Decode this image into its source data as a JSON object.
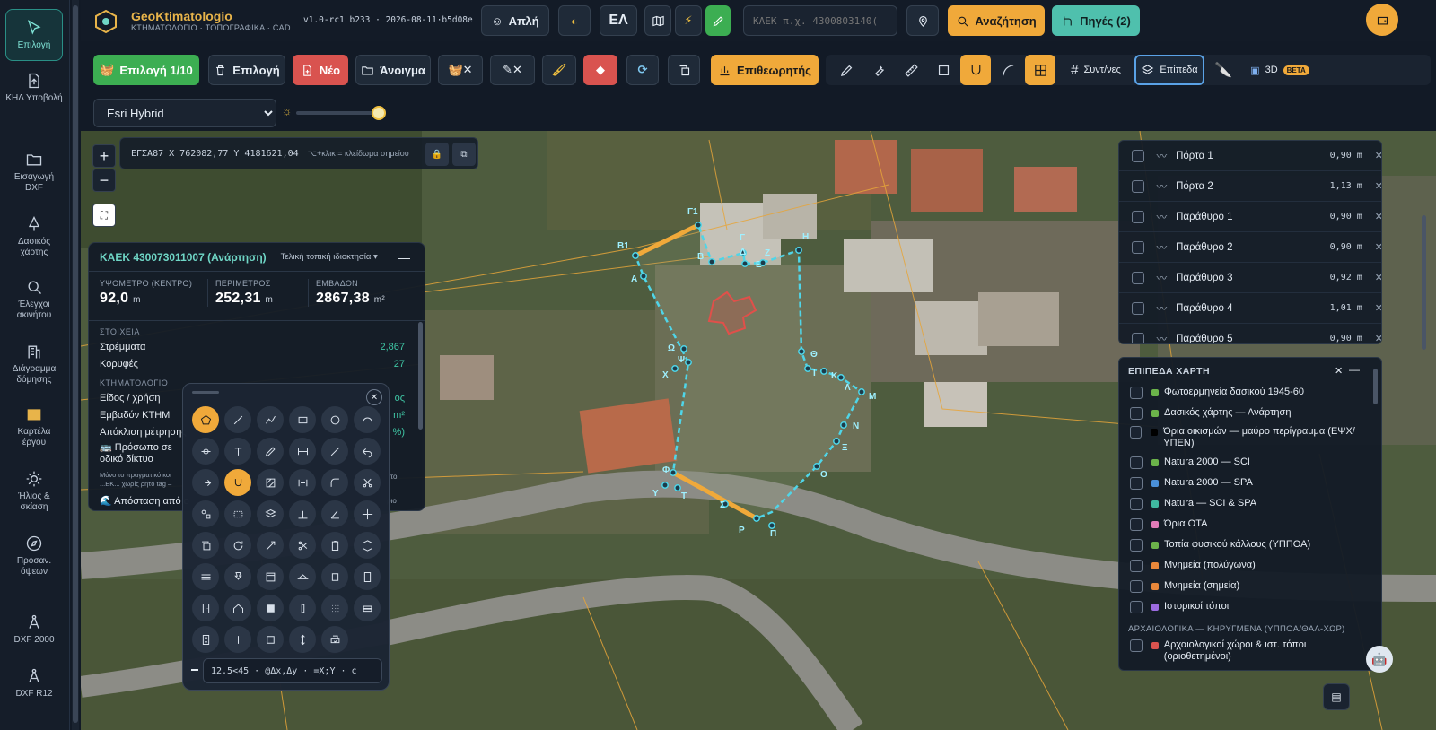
{
  "rail": [
    {
      "label": "Επιλογή",
      "icon": "cursor-icon"
    },
    {
      "label": "ΚΗΔ Υποβολή",
      "icon": "document-upload-icon"
    },
    {
      "label": "Εισαγωγή DXF",
      "icon": "folder-icon"
    },
    {
      "label": "Δασικός χάρτης",
      "icon": "tree-icon"
    },
    {
      "label": "Έλεγχοι ακινήτου",
      "icon": "search-icon"
    },
    {
      "label": "Διάγραμμα δόμησης",
      "icon": "building-icon"
    },
    {
      "label": "Καρτέλα έργου",
      "icon": "card-icon"
    },
    {
      "label": "Ήλιος & σκίαση",
      "icon": "sun-icon"
    },
    {
      "label": "Προσαν. όψεων",
      "icon": "compass-icon"
    },
    {
      "label": "DXF 2000",
      "icon": "compass-draw-icon"
    },
    {
      "label": "DXF R12",
      "icon": "compass-draw-icon"
    }
  ],
  "app": {
    "name": "GeoKtimatologio",
    "subtitle": "ΚΤΗΜΑΤΟΛΟΓΙΟ · ΤΟΠΟΓΡΑΦΙΚΑ · CAD",
    "version": "v1.0-rc1 b233 · 2026-08-11·b5d08e"
  },
  "topbar": {
    "mode_label": "Απλή",
    "lang_label": "ΕΛ",
    "search_placeholder": "ΚΑΕΚ π.χ. 4300803140(",
    "search_label": "Αναζήτηση",
    "sources_label": "Πηγές (2)"
  },
  "toolbar": {
    "select_count": "Επιλογή 1/10",
    "select_label": "Επιλογή",
    "new_label": "Νέο",
    "open_label": "Άνοιγμα",
    "viewer_label": "Επιθεωρητής",
    "grid_label": "Συντ/νες",
    "layers_label": "Επίπεδα",
    "d3_label": "3D",
    "beta": "BETA"
  },
  "basemap": {
    "selected": "Esri Hybrid",
    "options": [
      "Esri Hybrid"
    ]
  },
  "coord": {
    "text": "ΕΓΣΑ87 X 762082,77 Y 4181621,04",
    "hint": "⌥+κλικ = κλείδωμα σημείου"
  },
  "parcel": {
    "title": "ΚΑΕΚ 430073011007 (Ανάρτηση)",
    "ownership": "Τελική τοπική ιδιοκτησία",
    "stats": [
      {
        "label": "ΥΨΟΜΕΤΡΟ (ΚΕΝΤΡΟ)",
        "value": "92,0",
        "unit": "m"
      },
      {
        "label": "ΠΕΡΙΜΕΤΡΟΣ",
        "value": "252,31",
        "unit": "m"
      },
      {
        "label": "ΕΜΒΑΔΟΝ",
        "value": "2867,38",
        "unit": "m²"
      }
    ],
    "sec1": "ΣΤΟΙΧΕΙΑ",
    "rows1": [
      {
        "k": "Στρέμματα",
        "v": "2,867"
      },
      {
        "k": "Κορυφές",
        "v": "27"
      }
    ],
    "sec2": "ΚΤΗΜΑΤΟΛΟΓΙΟ",
    "rows2": [
      {
        "k": "Είδος / χρήση",
        "v": "ος"
      },
      {
        "k": "Εμβαδόν ΚΤΗΜ",
        "v": "m²"
      },
      {
        "k": "Απόκλιση μέτρησης",
        "v": "%)"
      }
    ],
    "road": "🚌 Πρόσωπο σε οδικό δίκτυο",
    "road_note": "Μόνο το πραγματικό κοι ...ΕΚ... χωρίς ρητό tag –",
    "road_note_r": "το",
    "distance": "🌊 Απόσταση από ο",
    "distance_r": "ριο"
  },
  "palette": {
    "input": "12.5<45 · @Δx,Δy · =X;Y · c"
  },
  "openings": [
    {
      "name": "Πόρτα 1",
      "value": "0,90 m"
    },
    {
      "name": "Πόρτα 2",
      "value": "1,13 m"
    },
    {
      "name": "Παράθυρο 1",
      "value": "0,90 m"
    },
    {
      "name": "Παράθυρο 2",
      "value": "0,90 m"
    },
    {
      "name": "Παράθυρο 3",
      "value": "0,92 m"
    },
    {
      "name": "Παράθυρο 4",
      "value": "1,01 m"
    },
    {
      "name": "Παράθυρο 5",
      "value": "0,90 m"
    }
  ],
  "layers": {
    "title": "ΕΠΙΠΕΔΑ ΧΑΡΤΗ",
    "items": [
      {
        "name": "Φωτοερμηνεία δασικού 1945-60",
        "color": "#6bb34a"
      },
      {
        "name": "Δασικός χάρτης — Ανάρτηση",
        "color": "#6bb34a"
      },
      {
        "name": "Όρια οικισμών — μαύρο περίγραμμα (ΕΨΧ/ΥΠΕΝ)",
        "color": "#000000"
      },
      {
        "name": "Natura 2000 — SCI",
        "color": "#6bb34a"
      },
      {
        "name": "Natura 2000 — SPA",
        "color": "#4a90d9"
      },
      {
        "name": "Natura — SCI & SPA",
        "color": "#3fb8a0"
      },
      {
        "name": "Όρια ΟΤΑ",
        "color": "#e07bb8"
      },
      {
        "name": "Τοπία φυσικού κάλλους (ΥΠΠΟΑ)",
        "color": "#6bb34a"
      },
      {
        "name": "Μνημεία (πολύγωνα)",
        "color": "#e8873a"
      },
      {
        "name": "Μνημεία (σημεία)",
        "color": "#e8873a"
      },
      {
        "name": "Ιστορικοί τόποι",
        "color": "#9b6be0"
      }
    ],
    "section": "ΑΡΧΑΙΟΛΟΓΙΚΑ — ΚΗΡΥΓΜΕΝΑ (ΥΠΠΟΑ/ΘΑΛ-ΧΩΡ)",
    "section_items": [
      {
        "name": "Αρχαιολογικοί χώροι & ιστ. τόποι (οριοθετημένοι)",
        "color": "#d9534f"
      }
    ]
  },
  "vertices": [
    "Β1",
    "Γ1",
    "Α",
    "Β",
    "Γ",
    "Δ",
    "Ε",
    "Ζ",
    "Η",
    "Ω",
    "Ψ",
    "Χ",
    "Θ",
    "Ι",
    "Κ",
    "Λ",
    "Μ",
    "Ν",
    "Ξ",
    "Ο",
    "Φ",
    "Υ",
    "Τ",
    "Σ",
    "Ρ",
    "Π"
  ]
}
